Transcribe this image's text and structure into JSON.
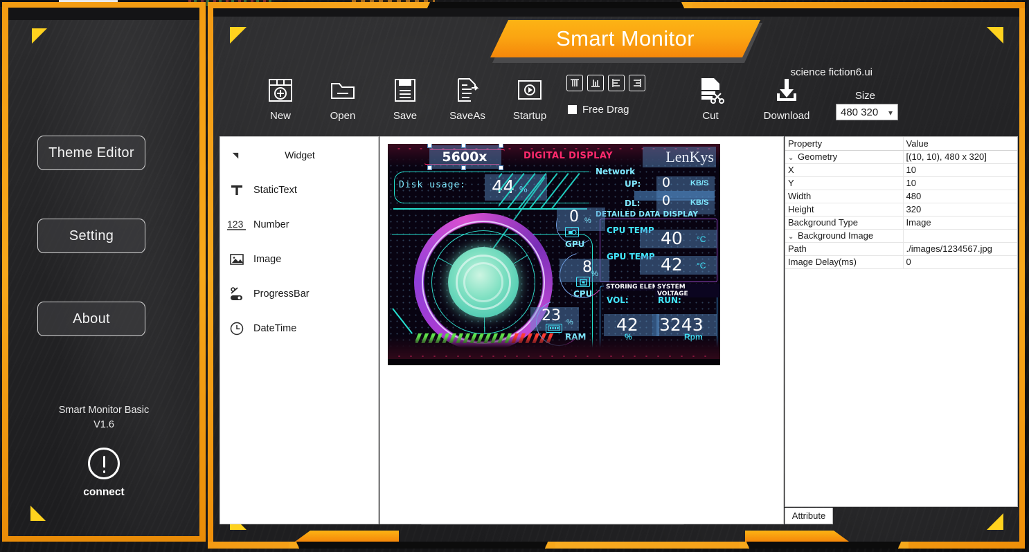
{
  "window": {
    "close_label": "✕",
    "title": "Smart Monitor"
  },
  "sidebar": {
    "buttons": [
      {
        "label": "Theme Editor",
        "name": "theme-editor-button"
      },
      {
        "label": "Setting",
        "name": "setting-button"
      },
      {
        "label": "About",
        "name": "about-button"
      }
    ],
    "version_line1": "Smart Monitor Basic",
    "version_line2": "V1.6",
    "connect_label": "connect",
    "connect_icon": "exclamation-circle-icon"
  },
  "toolbar": {
    "items": [
      {
        "label": "New",
        "icon": "new-file-icon"
      },
      {
        "label": "Open",
        "icon": "open-folder-icon"
      },
      {
        "label": "Save",
        "icon": "save-floppy-icon"
      },
      {
        "label": "SaveAs",
        "icon": "save-as-icon"
      },
      {
        "label": "Startup",
        "icon": "startup-play-icon"
      },
      {
        "label": "Cut",
        "icon": "cut-scissors-icon"
      },
      {
        "label": "Download",
        "icon": "download-arrow-icon"
      }
    ],
    "align_buttons": [
      {
        "icon": "align-top-icon"
      },
      {
        "icon": "align-bottom-icon"
      },
      {
        "icon": "align-left-icon"
      },
      {
        "icon": "align-right-icon"
      }
    ],
    "free_drag_label": "Free Drag",
    "free_drag_checked": false,
    "file_name": "science fiction6.ui",
    "size_label": "Size",
    "size_value": "480 320",
    "size_options": [
      "480 320"
    ]
  },
  "widget_panel": {
    "header": "Widget",
    "collapse_icon": "triangle-collapse-icon",
    "items": [
      {
        "label": "StaticText",
        "icon": "text-t-icon"
      },
      {
        "label": "Number",
        "icon": "number-123-icon"
      },
      {
        "label": "Image",
        "icon": "image-picture-icon"
      },
      {
        "label": "ProgressBar",
        "icon": "progress-bar-icon"
      },
      {
        "label": "DateTime",
        "icon": "clock-icon"
      }
    ]
  },
  "properties": {
    "columns": [
      "Property",
      "Value"
    ],
    "rows": [
      {
        "indent": 0,
        "expander": "⌄",
        "name": "Geometry",
        "value": "[(10, 10), 480 x 320]"
      },
      {
        "indent": 2,
        "expander": "",
        "name": "X",
        "value": "10"
      },
      {
        "indent": 2,
        "expander": "",
        "name": "Y",
        "value": "10"
      },
      {
        "indent": 2,
        "expander": "",
        "name": "Width",
        "value": "480"
      },
      {
        "indent": 2,
        "expander": "",
        "name": "Height",
        "value": "320"
      },
      {
        "indent": 1,
        "expander": "",
        "name": "Background Type",
        "value": "Image"
      },
      {
        "indent": 0,
        "expander": "⌄",
        "name": "Background Image",
        "value": ""
      },
      {
        "indent": 2,
        "expander": "",
        "name": "Path",
        "value": "./images/1234567.jpg"
      },
      {
        "indent": 2,
        "expander": "",
        "name": "Image Delay(ms)",
        "value": "0"
      }
    ]
  },
  "tabs": {
    "attribute": "Attribute"
  },
  "preview": {
    "header_title": "5600x",
    "header_title_selected": true,
    "digital_display": "DIGITAL DISPLAY",
    "brand": "LenKys",
    "disk_label": "Disk usage:",
    "disk_value": "44",
    "disk_unit": "%",
    "network": {
      "title": "Network",
      "up_label": "UP:",
      "up_value": "0",
      "up_unit": "KB/S",
      "dl_label": "DL:",
      "dl_value": "0",
      "dl_unit": "KB/S"
    },
    "detailed_header": "DETAILED DATA DISPLAY",
    "cpu_temp_label": "CPU TEMP",
    "cpu_temp_value": "40",
    "cpu_temp_unit": "°C",
    "gpu_temp_label": "GPU TEMP",
    "gpu_temp_value": "42",
    "gpu_temp_unit": "°C",
    "storing_element_label": "STORING ELEMENT",
    "system_voltage_label": "SYSTEM VOLTAGE",
    "vol_label": "VOL:",
    "vol_value": "42",
    "vol_unit": "%",
    "run_label": "RUN:",
    "run_value": "3243",
    "run_unit": "Rpm",
    "gauges": [
      {
        "label": "GPU",
        "value": "0",
        "unit": "%",
        "pct": 0,
        "icon": "gpu-card-icon"
      },
      {
        "label": "CPU",
        "value": "8",
        "unit": "%",
        "pct": 8,
        "icon": "cpu-chip-icon"
      },
      {
        "label": "RAM",
        "value": "23",
        "unit": "%",
        "pct": 23,
        "icon": "ram-stick-icon"
      }
    ]
  },
  "colors": {
    "accent_orange": "#f7a81b",
    "yellow_corner": "#ffd21e",
    "panel_dark": "#232325",
    "canvas_bg": "#080311",
    "neon_pink": "#ff2a6d",
    "neon_cyan": "#43e8ff",
    "neon_purple": "#a24dd6",
    "selection_blue": "#5a91c8"
  }
}
